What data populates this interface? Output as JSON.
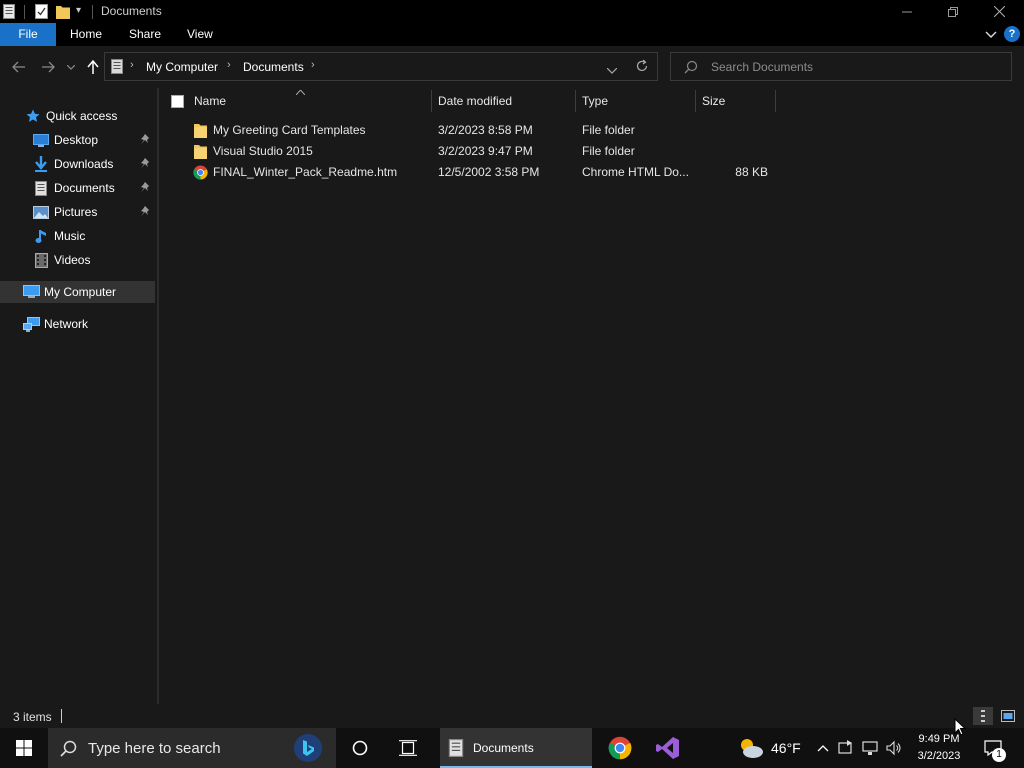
{
  "window": {
    "title": "Documents"
  },
  "ribbon": {
    "tabs": [
      "File",
      "Home",
      "Share",
      "View"
    ]
  },
  "address": {
    "path": [
      "My Computer",
      "Documents"
    ],
    "search_placeholder": "Search Documents"
  },
  "nav": {
    "quick_access": "Quick access",
    "items": [
      {
        "label": "Desktop",
        "icon": "desktop-icon",
        "pinned": true
      },
      {
        "label": "Downloads",
        "icon": "downloads-icon",
        "pinned": true
      },
      {
        "label": "Documents",
        "icon": "documents-icon",
        "pinned": true
      },
      {
        "label": "Pictures",
        "icon": "pictures-icon",
        "pinned": true
      },
      {
        "label": "Music",
        "icon": "music-icon",
        "pinned": false
      },
      {
        "label": "Videos",
        "icon": "videos-icon",
        "pinned": false
      }
    ],
    "my_computer": "My Computer",
    "network": "Network"
  },
  "columns": {
    "name": "Name",
    "date": "Date modified",
    "type": "Type",
    "size": "Size"
  },
  "files": [
    {
      "name": "My Greeting Card Templates",
      "date": "3/2/2023 8:58 PM",
      "type": "File folder",
      "size": "",
      "icon": "folder-icon"
    },
    {
      "name": "Visual Studio 2015",
      "date": "3/2/2023 9:47 PM",
      "type": "File folder",
      "size": "",
      "icon": "folder-icon"
    },
    {
      "name": "FINAL_Winter_Pack_Readme.htm",
      "date": "12/5/2002 3:58 PM",
      "type": "Chrome HTML Do...",
      "size": "88 KB",
      "icon": "chrome-icon"
    }
  ],
  "status": {
    "items_count": "3 items"
  },
  "taskbar": {
    "search_placeholder": "Type here to search",
    "active_app": "Documents",
    "weather": "46°F",
    "time": "9:49 PM",
    "date": "3/2/2023",
    "notification_count": "1"
  },
  "colors": {
    "accent": "#1a72c8",
    "folder": "#f1c75a",
    "background": "#191919"
  }
}
